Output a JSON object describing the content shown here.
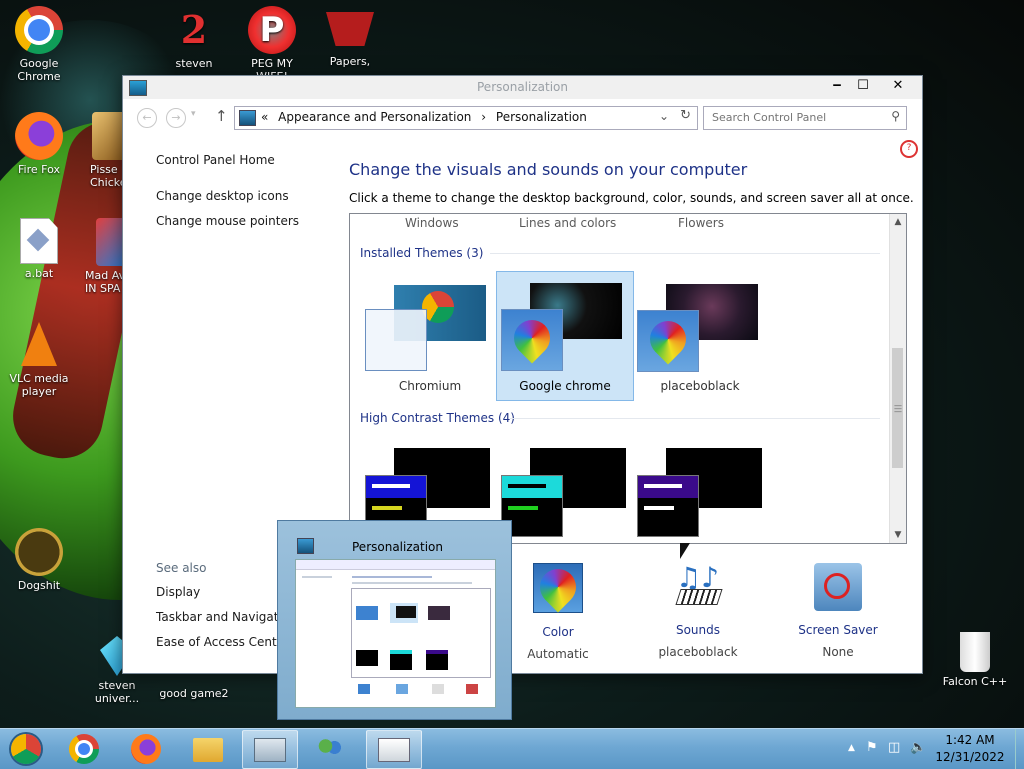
{
  "desktop": {
    "icons": [
      {
        "label": "Google Chrome",
        "icon": "chrome-icon"
      },
      {
        "label": "Fire Fox",
        "icon": "firefox-icon"
      },
      {
        "label": "a.bat",
        "icon": "batch-file-icon"
      },
      {
        "label": "VLC media player",
        "icon": "vlc-icon"
      },
      {
        "label": "Dogshit",
        "icon": "falcon-cpp-icon"
      },
      {
        "label": "steven univer...",
        "icon": "gem-icon"
      },
      {
        "label": "steven",
        "icon": "steven-icon"
      },
      {
        "label": "PEG MY WIFE!",
        "icon": "peggle-icon"
      },
      {
        "label": "Papers,",
        "icon": "papers-please-icon"
      },
      {
        "label": "Pisse Chicke",
        "icon": "game-icon"
      },
      {
        "label": "Mad Av IN SPA",
        "icon": "angry-birds-icon"
      },
      {
        "label": "good game2",
        "icon": "game-icon"
      },
      {
        "label": "Falcon C++",
        "icon": "recycle-bin-icon"
      }
    ]
  },
  "window": {
    "title": "Personalization",
    "controls": {
      "minimize": "‒",
      "maximize": "☐",
      "close": "✕"
    },
    "address": {
      "crumbs": [
        "«",
        "Appearance and Personalization",
        "›",
        "Personalization"
      ]
    },
    "search": {
      "placeholder": "Search Control Panel"
    },
    "left_nav": {
      "home": "Control Panel Home",
      "links": [
        "Change desktop icons",
        "Change mouse pointers"
      ],
      "see_also_header": "See also",
      "see_also": [
        "Display",
        "Taskbar and Navigation",
        "Ease of Access Center"
      ]
    },
    "heading": "Change the visuals and sounds on your computer",
    "description": "Click a theme to change the desktop background, color, sounds, and screen saver all at once.",
    "themes": {
      "top_labels": [
        "Windows",
        "Lines and colors",
        "Flowers"
      ],
      "installed_header": "Installed Themes (3)",
      "installed": [
        {
          "name": "Chromium",
          "selected": false
        },
        {
          "name": "Google chrome",
          "selected": true
        },
        {
          "name": "placeboblack",
          "selected": false
        }
      ],
      "high_contrast_header": "High Contrast Themes (4)"
    },
    "bottom": [
      {
        "label": "Color",
        "sub": "Automatic",
        "icon": "color-icon"
      },
      {
        "label": "Sounds",
        "sub": "placeboblack",
        "icon": "sounds-icon"
      },
      {
        "label": "Screen Saver",
        "sub": "None",
        "icon": "screen-saver-icon"
      }
    ]
  },
  "preview": {
    "title": "Personalization"
  },
  "taskbar": {
    "items": [
      "start-orb-icon",
      "chrome-icon",
      "firefox-icon",
      "explorer-icon",
      "monitor-icon",
      "people-icon",
      "control-panel-icon"
    ],
    "clock": {
      "time": "1:42 AM",
      "date": "12/31/2022"
    }
  }
}
